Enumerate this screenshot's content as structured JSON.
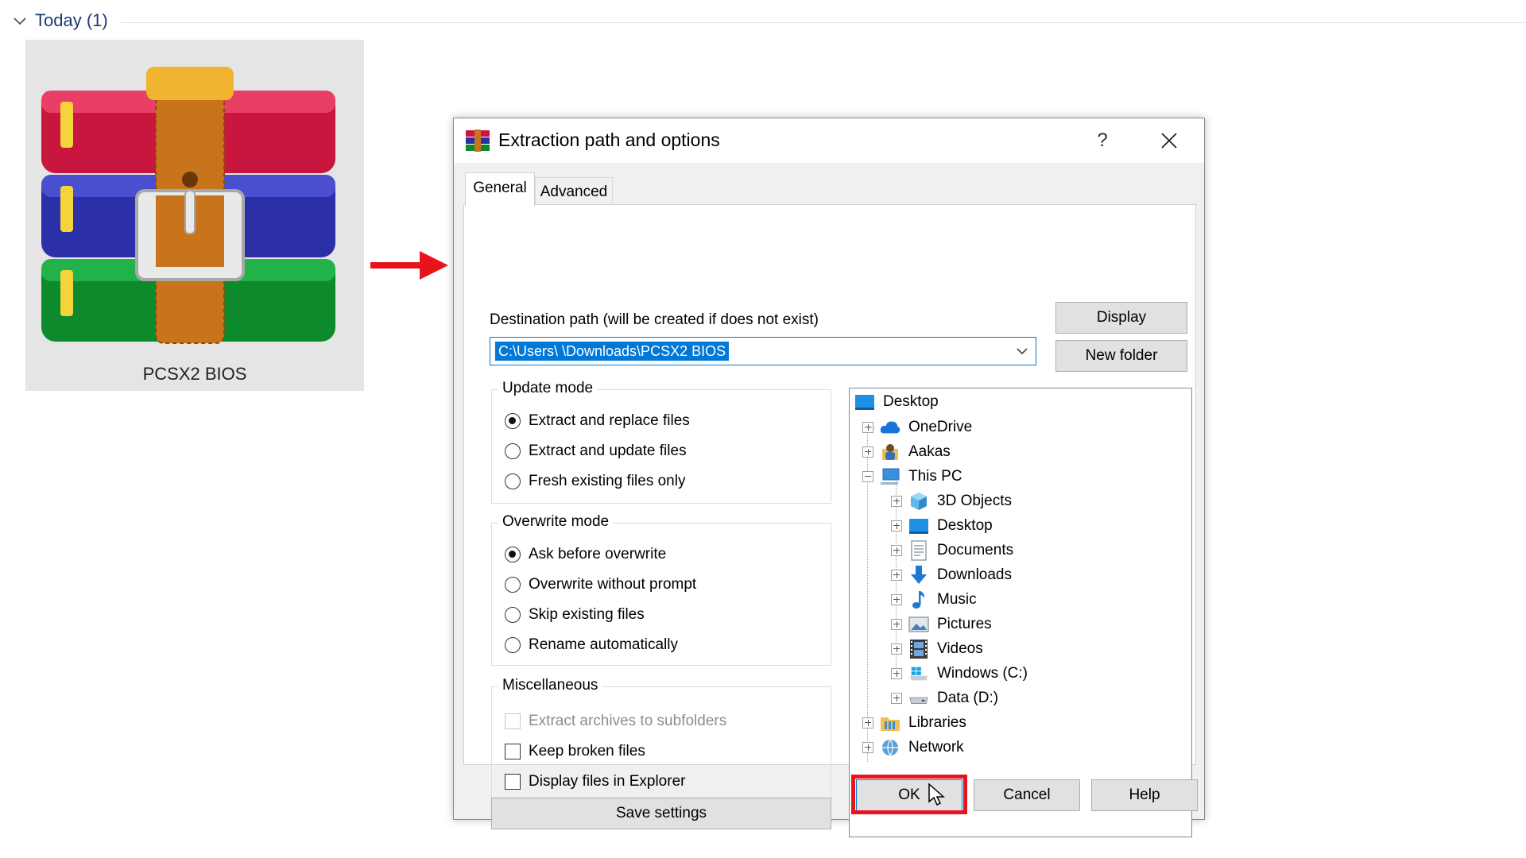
{
  "explorer": {
    "group_label": "Today (1)",
    "file_name": "PCSX2 BIOS"
  },
  "dialog": {
    "title": "Extraction path and options",
    "help_glyph": "?",
    "tabs": [
      {
        "label": "General"
      },
      {
        "label": "Advanced"
      }
    ],
    "destination_label": "Destination path (will be created if does not exist)",
    "destination_value": "C:\\Users\\      \\Downloads\\PCSX2 BIOS",
    "buttons": {
      "display": "Display",
      "new_folder": "New folder",
      "save_settings": "Save settings",
      "ok": "OK",
      "cancel": "Cancel",
      "help": "Help"
    },
    "update_mode": {
      "title": "Update mode",
      "options": [
        "Extract and replace files",
        "Extract and update files",
        "Fresh existing files only"
      ],
      "selected_index": 0
    },
    "overwrite_mode": {
      "title": "Overwrite mode",
      "options": [
        "Ask before overwrite",
        "Overwrite without prompt",
        "Skip existing files",
        "Rename automatically"
      ],
      "selected_index": 0
    },
    "miscellaneous": {
      "title": "Miscellaneous",
      "options": [
        {
          "label": "Extract archives to subfolders",
          "checked": false,
          "enabled": false
        },
        {
          "label": "Keep broken files",
          "checked": false,
          "enabled": true
        },
        {
          "label": "Display files in Explorer",
          "checked": false,
          "enabled": true
        }
      ]
    },
    "tree": [
      {
        "label": "Desktop",
        "icon": "desktop-icon",
        "level": 0,
        "expander": "none"
      },
      {
        "label": "OneDrive",
        "icon": "onedrive-cloud-icon",
        "level": 1,
        "expander": "plus"
      },
      {
        "label": "Aakas",
        "icon": "user-folder-icon",
        "level": 1,
        "expander": "plus"
      },
      {
        "label": "This PC",
        "icon": "this-pc-icon",
        "level": 1,
        "expander": "minus"
      },
      {
        "label": "3D Objects",
        "icon": "3d-objects-icon",
        "level": 2,
        "expander": "plus"
      },
      {
        "label": "Desktop",
        "icon": "desktop-icon",
        "level": 2,
        "expander": "plus"
      },
      {
        "label": "Documents",
        "icon": "documents-icon",
        "level": 2,
        "expander": "plus"
      },
      {
        "label": "Downloads",
        "icon": "downloads-icon",
        "level": 2,
        "expander": "plus"
      },
      {
        "label": "Music",
        "icon": "music-icon",
        "level": 2,
        "expander": "plus"
      },
      {
        "label": "Pictures",
        "icon": "pictures-icon",
        "level": 2,
        "expander": "plus"
      },
      {
        "label": "Videos",
        "icon": "videos-icon",
        "level": 2,
        "expander": "plus"
      },
      {
        "label": "Windows (C:)",
        "icon": "windows-drive-icon",
        "level": 2,
        "expander": "plus"
      },
      {
        "label": "Data (D:)",
        "icon": "drive-icon",
        "level": 2,
        "expander": "plus"
      },
      {
        "label": "Libraries",
        "icon": "libraries-icon",
        "level": 1,
        "expander": "plus"
      },
      {
        "label": "Network",
        "icon": "network-icon",
        "level": 1,
        "expander": "plus"
      }
    ],
    "colors": {
      "selection": "#0078d7",
      "highlight_box": "#e8141c"
    }
  }
}
